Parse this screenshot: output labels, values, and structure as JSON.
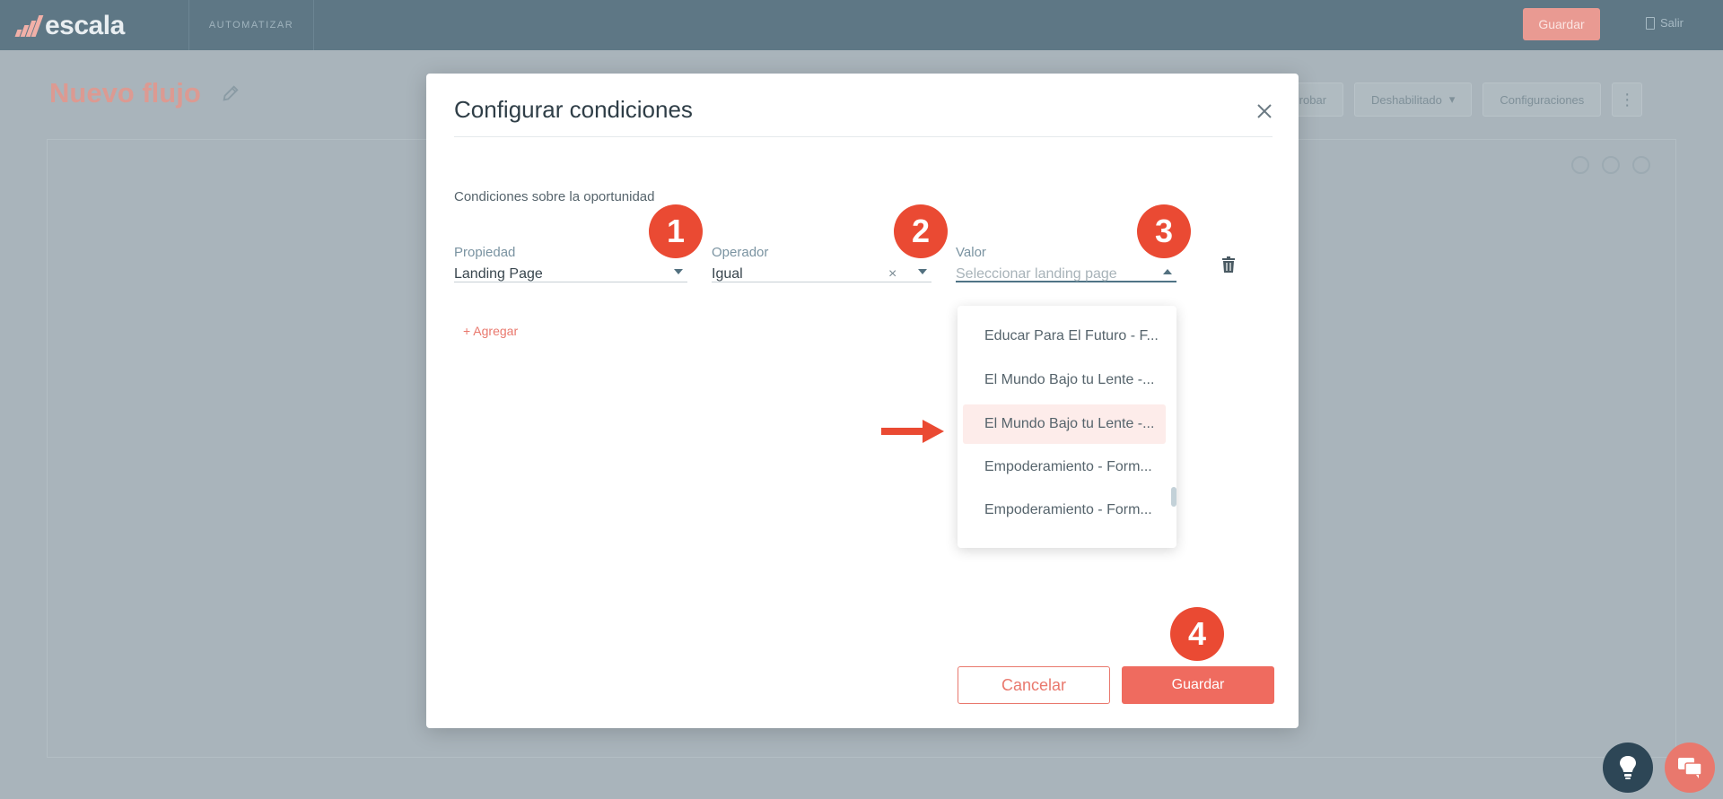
{
  "app": {
    "logo_text": "escala",
    "nav_tab": "AUTOMATIZAR",
    "top_save": "Guardar",
    "top_exit": "Salir",
    "flow_title": "Nuevo flujo",
    "actions": [
      "Probar",
      "Deshabilitado",
      "Configuraciones"
    ]
  },
  "modal": {
    "title": "Configurar condiciones",
    "section_label": "Condiciones sobre la oportunidad",
    "property": {
      "label": "Propiedad",
      "value": "Landing Page"
    },
    "operator": {
      "label": "Operador",
      "value": "Igual"
    },
    "value_field": {
      "label": "Valor",
      "placeholder": "Seleccionar landing page"
    },
    "add_label": "+ Agregar",
    "dropdown_options": [
      "Educar Para El Futuro - F...",
      "El Mundo Bajo tu Lente -...",
      "El Mundo Bajo tu Lente -...",
      "Empoderamiento - Form...",
      "Empoderamiento - Form..."
    ],
    "highlighted_index": 2,
    "cancel_label": "Cancelar",
    "save_label": "Guardar"
  },
  "annotations": {
    "steps": [
      "1",
      "2",
      "3",
      "4"
    ],
    "accent": "#ea4a33"
  },
  "colors": {
    "brand": "#ef6b5f",
    "topbar": "#5e7785",
    "label": "#7a93a1"
  }
}
